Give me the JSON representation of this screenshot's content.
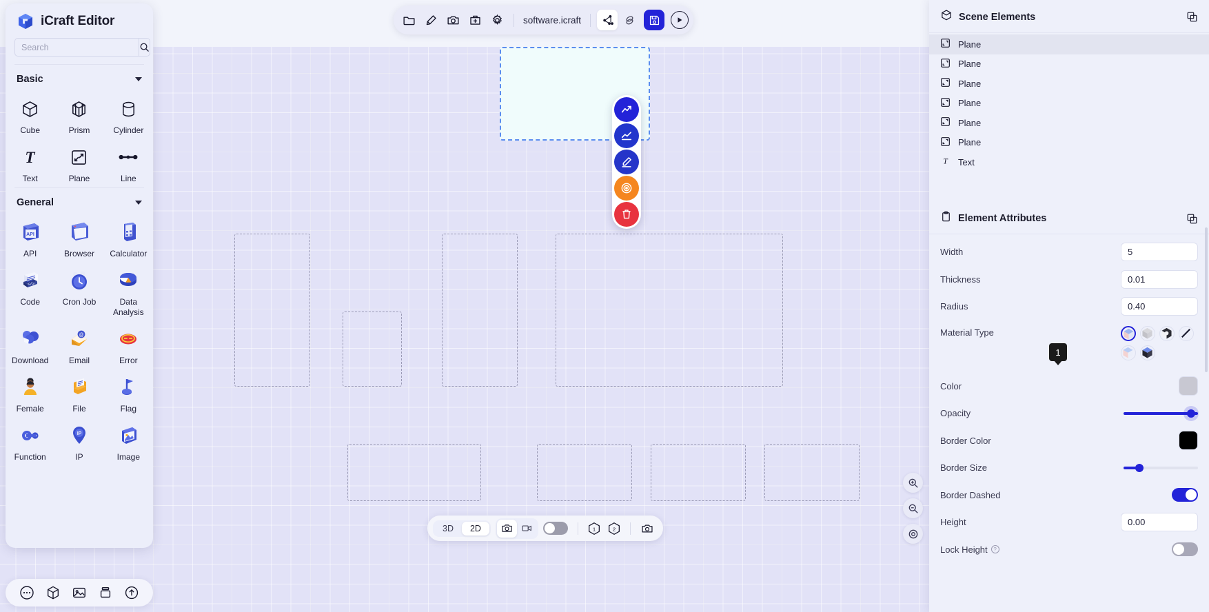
{
  "app": {
    "title": "iCraft Editor",
    "logo_icon": "cube-logo-icon"
  },
  "search": {
    "placeholder": "Search",
    "value": "",
    "button_icon": "search-icon"
  },
  "palette": {
    "groups": [
      {
        "title": "Basic",
        "caret_icon": "chevron-down-icon",
        "items": [
          {
            "label": "Cube",
            "icon": "cube-icon"
          },
          {
            "label": "Prism",
            "icon": "prism-icon"
          },
          {
            "label": "Cylinder",
            "icon": "cylinder-icon"
          },
          {
            "label": "Text",
            "icon": "text-icon"
          },
          {
            "label": "Plane",
            "icon": "plane-icon"
          },
          {
            "label": "Line",
            "icon": "line-icon"
          }
        ]
      },
      {
        "title": "General",
        "caret_icon": "chevron-down-icon",
        "items": [
          {
            "label": "API",
            "icon": "api-icon"
          },
          {
            "label": "Browser",
            "icon": "browser-icon"
          },
          {
            "label": "Calculator",
            "icon": "calculator-icon"
          },
          {
            "label": "Code",
            "icon": "code-icon"
          },
          {
            "label": "Cron Job",
            "icon": "cron-job-icon"
          },
          {
            "label": "Data Analysis",
            "icon": "data-analysis-icon"
          },
          {
            "label": "Download",
            "icon": "download-icon"
          },
          {
            "label": "Email",
            "icon": "email-icon"
          },
          {
            "label": "Error",
            "icon": "error-icon"
          },
          {
            "label": "Female",
            "icon": "female-icon"
          },
          {
            "label": "File",
            "icon": "file-icon"
          },
          {
            "label": "Flag",
            "icon": "flag-icon"
          },
          {
            "label": "Function",
            "icon": "function-icon"
          },
          {
            "label": "IP",
            "icon": "ip-icon"
          },
          {
            "label": "Image",
            "icon": "image-icon"
          }
        ]
      }
    ]
  },
  "sidebar_dock": {
    "items": [
      {
        "icon": "more-dots-icon"
      },
      {
        "icon": "box-3d-icon"
      },
      {
        "icon": "picture-icon"
      },
      {
        "icon": "layers-icon"
      },
      {
        "icon": "upload-circle-icon"
      }
    ]
  },
  "toolbar": {
    "file_name": "software.icraft",
    "left_icons": [
      {
        "icon": "folder-icon"
      },
      {
        "icon": "pen-highlight-icon"
      },
      {
        "icon": "camera-icon"
      },
      {
        "icon": "add-frame-icon"
      },
      {
        "icon": "gear-icon"
      }
    ],
    "right_icons": [
      {
        "icon": "share-nodes-icon",
        "active": true
      },
      {
        "icon": "link-rings-icon",
        "active": false
      }
    ],
    "save_icon": "save-floppy-icon",
    "play_icon": "play-circle-icon"
  },
  "fab": {
    "buttons": [
      {
        "icon": "trend-arrow-icon",
        "color": "#2323d8"
      },
      {
        "icon": "chart-line-icon",
        "color": "#2235cc"
      },
      {
        "icon": "pencil-edit-icon",
        "color": "#2535c9"
      },
      {
        "icon": "target-icon",
        "color": "#f5861f"
      },
      {
        "icon": "trash-icon",
        "color": "#e8333f"
      }
    ]
  },
  "bottom_toolbar": {
    "view_modes": [
      {
        "label": "3D",
        "active": false
      },
      {
        "label": "2D",
        "active": true
      }
    ],
    "capture_icons": [
      {
        "icon": "camera-icon",
        "active": true
      },
      {
        "icon": "video-icon",
        "active": false
      }
    ],
    "toggle_on": false,
    "numbers": [
      {
        "label": "1",
        "icon": "hex-one-icon"
      },
      {
        "label": "2",
        "icon": "hex-two-icon"
      }
    ],
    "screenshot_icon": "camera-plus-icon"
  },
  "zoom_controls": {
    "buttons": [
      {
        "icon": "zoom-in-icon"
      },
      {
        "icon": "zoom-out-icon"
      },
      {
        "icon": "fit-view-icon"
      }
    ]
  },
  "scene_elements": {
    "title": "Scene Elements",
    "header_icon": "cube-outline-icon",
    "action_icon": "collapse-panel-icon",
    "items": [
      {
        "label": "Plane",
        "icon": "plane-icon",
        "selected": true
      },
      {
        "label": "Plane",
        "icon": "plane-icon",
        "selected": false
      },
      {
        "label": "Plane",
        "icon": "plane-icon",
        "selected": false
      },
      {
        "label": "Plane",
        "icon": "plane-icon",
        "selected": false
      },
      {
        "label": "Plane",
        "icon": "plane-icon",
        "selected": false
      },
      {
        "label": "Plane",
        "icon": "plane-icon",
        "selected": false
      },
      {
        "label": "Text",
        "icon": "text-icon",
        "selected": false
      }
    ]
  },
  "element_attributes": {
    "title": "Element Attributes",
    "header_icon": "clipboard-icon",
    "action_icon": "duplicate-icon",
    "fields": {
      "width_label": "Width",
      "width_value": "5",
      "thickness_label": "Thickness",
      "thickness_value": "0.01",
      "radius_label": "Radius",
      "radius_value": "0.40",
      "material_label": "Material Type",
      "color_label": "Color",
      "opacity_label": "Opacity",
      "opacity_tooltip": "1",
      "border_color_label": "Border Color",
      "border_color_value": "#000000",
      "border_size_label": "Border Size",
      "border_dashed_label": "Border Dashed",
      "height_label": "Height",
      "height_value": "0.00",
      "lock_height_label": "Lock Height"
    },
    "materials": [
      {
        "name": "material-glossy",
        "selected": true
      },
      {
        "name": "material-matte",
        "selected": false
      },
      {
        "name": "material-wireframe",
        "selected": false
      },
      {
        "name": "material-line",
        "selected": false
      },
      {
        "name": "material-translucent",
        "selected": false
      },
      {
        "name": "material-dark",
        "selected": false
      }
    ]
  },
  "colors": {
    "accent": "#2323d8",
    "canvas_bg": "#e2e2f7",
    "panel_bg": "#eef0fa",
    "sidebar_bg": "#eceefa",
    "selected_plane_fill": "#f0fcfc",
    "selected_plane_border": "#5b8def"
  }
}
